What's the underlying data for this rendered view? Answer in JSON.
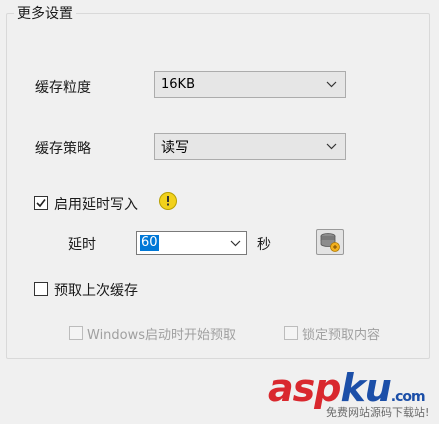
{
  "group": {
    "title": "更多设置"
  },
  "cache_granularity": {
    "label": "缓存粒度",
    "value": "16KB"
  },
  "cache_strategy": {
    "label": "缓存策略",
    "value": "读写"
  },
  "delayed_write": {
    "label": "启用延时写入",
    "checked": true
  },
  "delay": {
    "label": "延时",
    "value": "60",
    "unit": "秒"
  },
  "prefetch_last": {
    "label": "预取上次缓存",
    "checked": false
  },
  "prefetch_on_start": {
    "label": "Windows启动时开始预取",
    "checked": false,
    "enabled": false
  },
  "lock_prefetch": {
    "label": "锁定预取内容",
    "checked": false,
    "enabled": false
  },
  "icons": {
    "warning": "warning-icon",
    "database": "database-icon",
    "dropdown": "chevron-down-icon"
  },
  "watermark": {
    "brand_a": "asp",
    "brand_b": "ku",
    "suffix": ".com",
    "tagline": "免费网站源码下载站!"
  },
  "colors": {
    "selection": "#0078d7",
    "warning": "#f2d11c",
    "brand_red": "#d9282e",
    "brand_blue": "#1c4fa8"
  }
}
